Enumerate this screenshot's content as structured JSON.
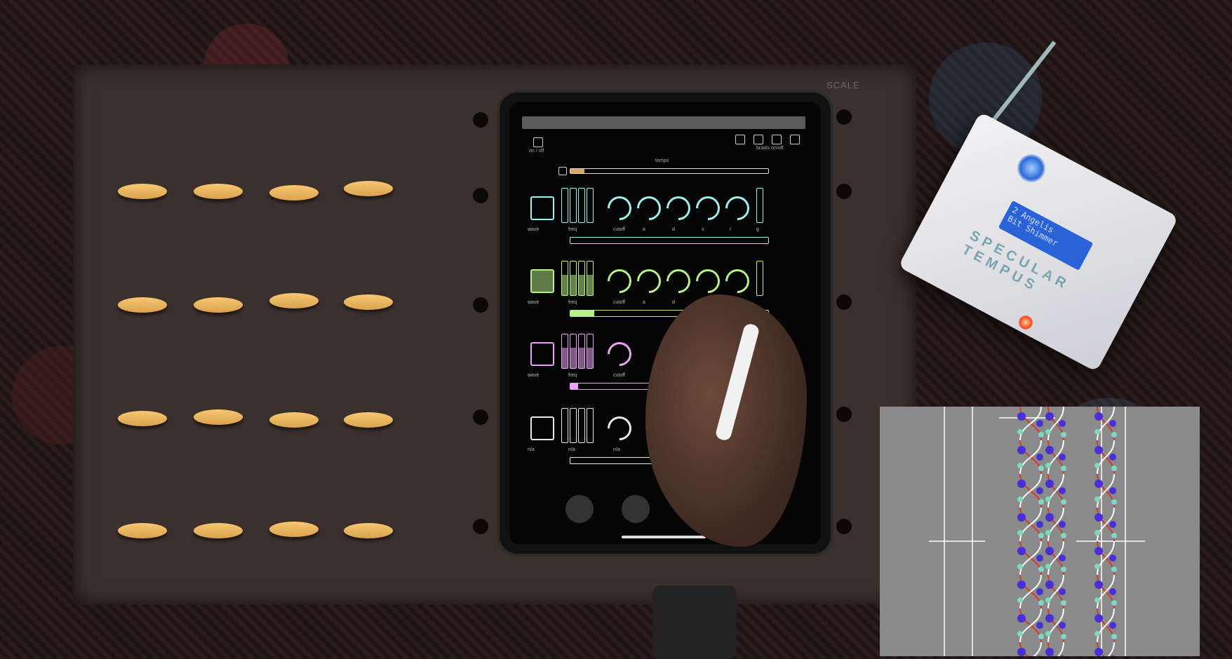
{
  "board": {
    "label_scale": "SCALE"
  },
  "ipad": {
    "on_off_label": "on / off",
    "tempo_label": "tempo",
    "braids_label": "braids on/off",
    "channels": [
      {
        "color": "#9ef0ef",
        "labels": [
          "wave",
          "freq",
          "cutoff",
          "a",
          "d",
          "s",
          "r",
          "g"
        ],
        "fill": 0.0
      },
      {
        "color": "#b8f08a",
        "labels": [
          "wave",
          "freq",
          "cutoff",
          "a",
          "d"
        ],
        "fill": 0.12
      },
      {
        "color": "#e8a6f2",
        "labels": [
          "wave",
          "freq",
          "cutoff"
        ],
        "fill": 0.04
      },
      {
        "color": "#e8e8e8",
        "labels": [
          "n/a",
          "n/a",
          "n/a"
        ],
        "fill": 0.0
      }
    ],
    "tempo_fill": 0.07
  },
  "pedal": {
    "screen_line1": "2 Angelis",
    "screen_line2": "Bit Shimmer",
    "name": "SPECULAR TEMPUS"
  },
  "colors": {
    "accent_blue": "#2b6bd6",
    "node_cyan": "#7fd7c4",
    "node_purple": "#4a2fd6",
    "line_red": "#d23a2a"
  }
}
